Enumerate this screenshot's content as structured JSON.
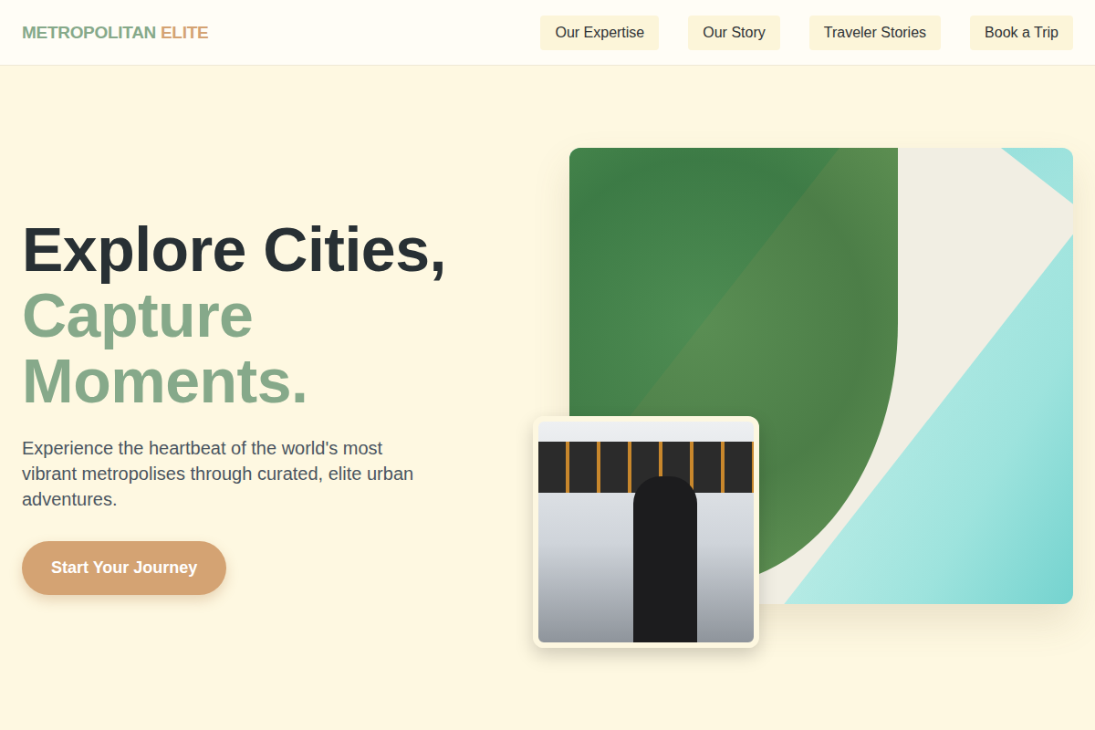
{
  "header": {
    "logo": {
      "primary": "METROPOLITAN",
      "accent": "ELITE"
    },
    "nav": [
      {
        "label": "Our Expertise"
      },
      {
        "label": "Our Story"
      },
      {
        "label": "Traveler Stories"
      },
      {
        "label": "Book a Trip"
      }
    ]
  },
  "hero": {
    "title_lines": [
      {
        "text": "Explore Cities,",
        "accent": false
      },
      {
        "text": "Capture",
        "accent": true
      },
      {
        "text": "Moments.",
        "accent": true
      }
    ],
    "subtitle": "Experience the heartbeat of the world's most vibrant metropolises through curated, elite urban adventures.",
    "cta": "Start Your Journey"
  }
}
